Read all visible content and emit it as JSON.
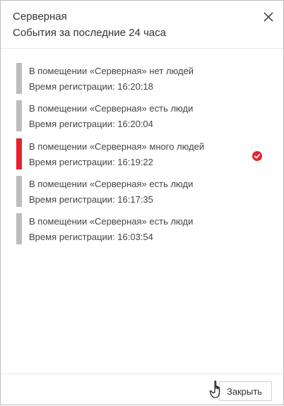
{
  "dialog": {
    "title": "Серверная",
    "subtitle": "События за последние 24 часа",
    "close_icon": "close-icon",
    "close_button_label": "Закрыть"
  },
  "colors": {
    "normal_bar": "#bdbdbd",
    "alert_bar": "#e8212e",
    "check": "#e8212e"
  },
  "events": [
    {
      "message": "В помещении «Серверная» нет людей",
      "time": "Время регистрации: 16:20:18",
      "status": "normal",
      "acknowledged": false
    },
    {
      "message": "В помещении «Серверная» есть люди",
      "time": "Время регистрации: 16:20:04",
      "status": "normal",
      "acknowledged": false
    },
    {
      "message": "В помещении «Серверная» много людей",
      "time": "Время регистрации: 16:19:22",
      "status": "alert",
      "acknowledged": true
    },
    {
      "message": "В помещении «Серверная» есть люди",
      "time": "Время регистрации: 16:17:35",
      "status": "normal",
      "acknowledged": false
    },
    {
      "message": "В помещении «Серверная» есть люди",
      "time": "Время регистрации: 16:03:54",
      "status": "normal",
      "acknowledged": false
    }
  ]
}
